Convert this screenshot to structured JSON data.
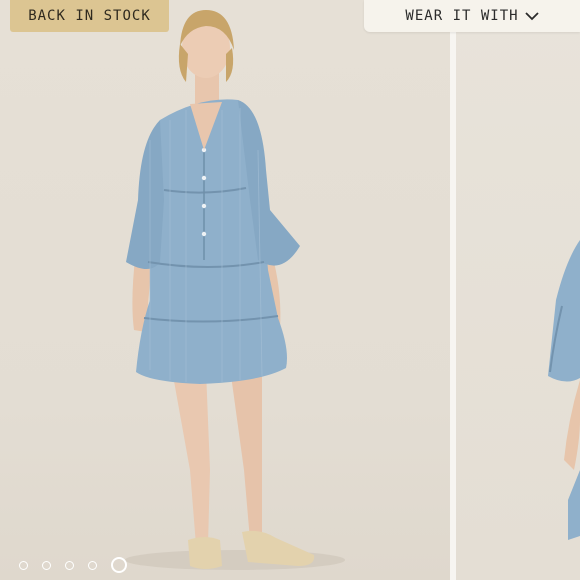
{
  "badge": {
    "label": "BACK IN STOCK"
  },
  "wear_it_with": {
    "label": "WEAR IT WITH",
    "icon": "chevron-down-icon"
  },
  "carousel": {
    "slide_count": 5,
    "active_index": 4
  },
  "colors": {
    "badge_bg": "#dcc592",
    "button_bg": "#f6f3ec",
    "dress": "#8fb0cb"
  }
}
